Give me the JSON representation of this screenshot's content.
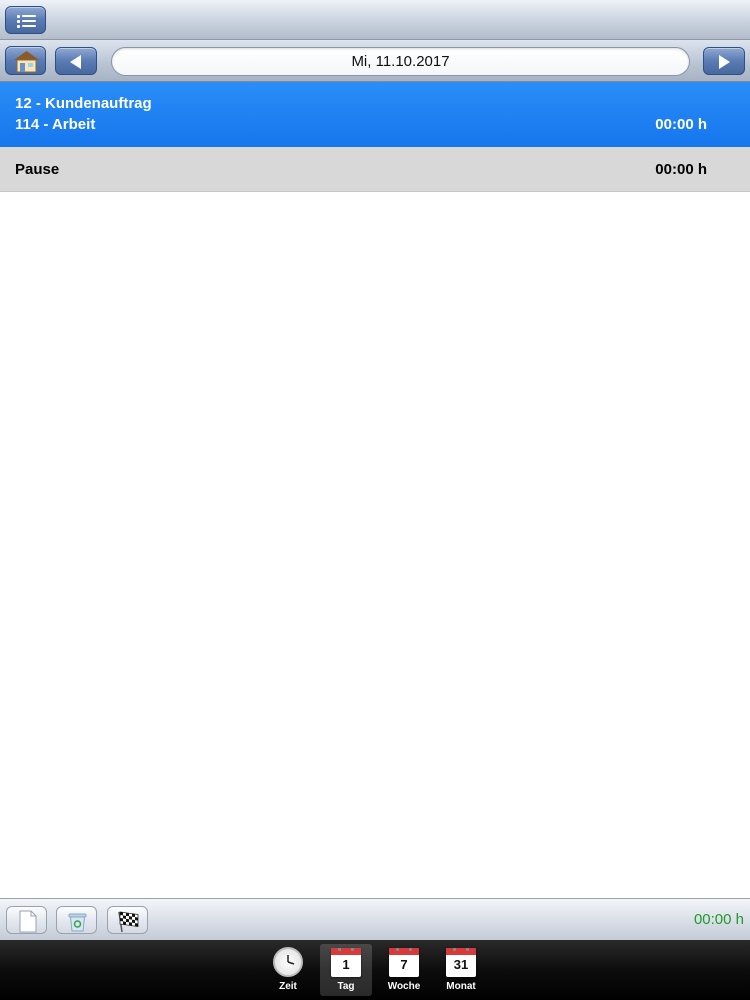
{
  "navbar": {
    "date": "Mi, 11.10.2017"
  },
  "entries": [
    {
      "order": "12 - Kundenauftrag",
      "activity": "114 - Arbeit",
      "duration": "00:00 h"
    }
  ],
  "pause": {
    "label": "Pause",
    "duration": "00:00 h"
  },
  "toolbar": {
    "total": "00:00 h",
    "total_color": "#1f9a2a"
  },
  "tabs": [
    {
      "label": "Zeit",
      "icon": "clock-icon"
    },
    {
      "label": "Tag",
      "icon": "calendar-day-icon",
      "number": "1"
    },
    {
      "label": "Woche",
      "icon": "calendar-week-icon",
      "number": "7"
    },
    {
      "label": "Monat",
      "icon": "calendar-month-icon",
      "number": "31"
    }
  ],
  "colors": {
    "selected_row": "#1a7ef2",
    "pause_row": "#d8d8d8"
  }
}
